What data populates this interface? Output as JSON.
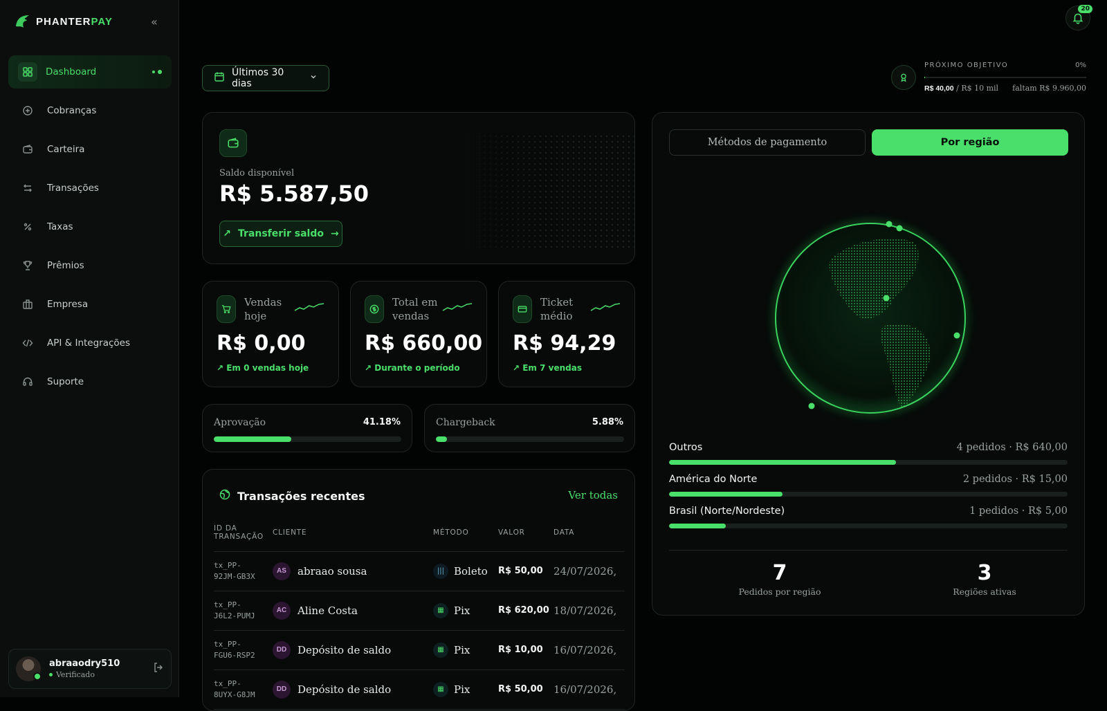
{
  "brand": {
    "name_part1": "PHANTER",
    "name_part2": "PAY"
  },
  "sidebar": {
    "items": [
      {
        "label": "Dashboard",
        "icon": "grid-icon",
        "active": true
      },
      {
        "label": "Cobranças",
        "icon": "plus-circle-icon"
      },
      {
        "label": "Carteira",
        "icon": "wallet-icon"
      },
      {
        "label": "Transações",
        "icon": "arrows-icon"
      },
      {
        "label": "Taxas",
        "icon": "percent-icon"
      },
      {
        "label": "Prêmios",
        "icon": "trophy-icon"
      },
      {
        "label": "Empresa",
        "icon": "building-icon"
      },
      {
        "label": "API & Integrações",
        "icon": "code-icon"
      },
      {
        "label": "Suporte",
        "icon": "headset-icon"
      }
    ],
    "user": {
      "name": "abraaodry510",
      "status": "Verificado"
    }
  },
  "header": {
    "notifications": "20"
  },
  "filter": {
    "period": "Últimos 30 dias"
  },
  "goal": {
    "label": "PRÓXIMO OBJETIVO",
    "percent": "0%",
    "progress": 0.004,
    "current": "R$ 40,00",
    "target": "/ R$ 10 mil",
    "remaining": "faltam R$ 9.960,00"
  },
  "balance": {
    "label": "Saldo disponível",
    "value": "R$ 5.587,50",
    "transfer_label": "Transferir saldo"
  },
  "stats": [
    {
      "label": "Vendas hoje",
      "value": "R$ 0,00",
      "sub": "Em 0 vendas hoje"
    },
    {
      "label": "Total em vendas",
      "value": "R$ 660,00",
      "sub": "Durante o período"
    },
    {
      "label": "Ticket médio",
      "value": "R$ 94,29",
      "sub": "Em 7 vendas"
    }
  ],
  "rates": [
    {
      "label": "Aprovação",
      "value": "41.18%",
      "fraction": 0.4118
    },
    {
      "label": "Chargeback",
      "value": "5.88%",
      "fraction": 0.0588
    }
  ],
  "transactions": {
    "title": "Transações recentes",
    "view_all": "Ver todas",
    "columns": [
      "ID DA TRANSAÇÃO",
      "CLIENTE",
      "MÉTODO",
      "VALOR",
      "DATA"
    ],
    "rows": [
      {
        "id1": "tx_PP-",
        "id2": "92JM-GB3X",
        "initials": "AS",
        "client": "abraao sousa",
        "method": "Boleto",
        "value": "R$ 50,00",
        "date": "24/07/2026,"
      },
      {
        "id1": "tx_PP-",
        "id2": "J6L2-PUMJ",
        "initials": "AC",
        "client": "Aline Costa",
        "method": "Pix",
        "value": "R$ 620,00",
        "date": "18/07/2026,"
      },
      {
        "id1": "tx_PP-",
        "id2": "FGU6-RSP2",
        "initials": "DD",
        "client": "Depósito de saldo",
        "method": "Pix",
        "value": "R$ 10,00",
        "date": "16/07/2026,"
      },
      {
        "id1": "tx_PP-",
        "id2": "8UYX-G8JM",
        "initials": "DD",
        "client": "Depósito de saldo",
        "method": "Pix",
        "value": "R$ 50,00",
        "date": "16/07/2026,"
      }
    ]
  },
  "region_panel": {
    "tabs": [
      "Métodos de pagamento",
      "Por região"
    ],
    "regions": [
      {
        "name": "Outros",
        "info": "4 pedidos · R$ 640,00",
        "fraction": 0.57
      },
      {
        "name": "América do Norte",
        "info": "2 pedidos · R$ 15,00",
        "fraction": 0.285
      },
      {
        "name": "Brasil (Norte/Nordeste)",
        "info": "1 pedidos · R$ 5,00",
        "fraction": 0.142
      }
    ],
    "kpis": [
      {
        "value": "7",
        "label": "Pedidos por região"
      },
      {
        "value": "3",
        "label": "Regiões ativas"
      }
    ]
  },
  "colors": {
    "accent": "#4ade6a",
    "background": "#020403",
    "card": "#070a09"
  }
}
